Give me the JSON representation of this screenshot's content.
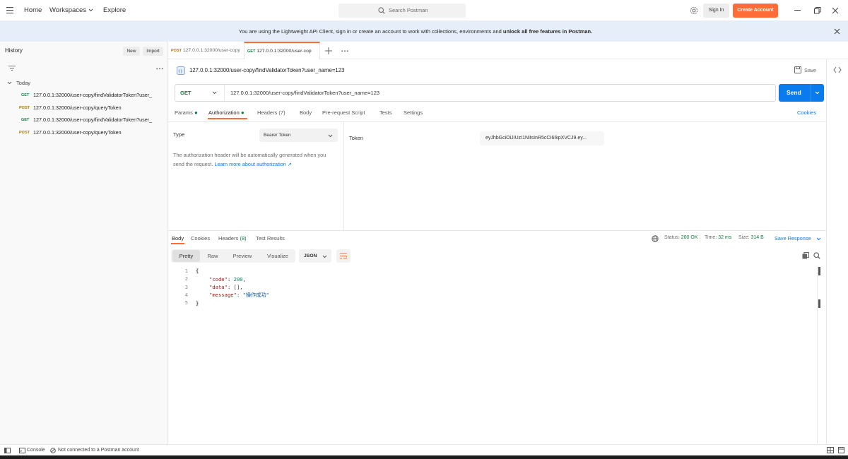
{
  "topbar": {
    "nav": [
      "Home",
      "Workspaces",
      "Explore"
    ],
    "search_placeholder": "Search Postman",
    "signin_label": "Sign In",
    "create_label": "Create Account"
  },
  "banner": {
    "text_plain": "You are using the Lightweight API Client, sign in or create an account to work with collections, environments and ",
    "text_bold": "unlock all free features in Postman."
  },
  "sidebar": {
    "title": "History",
    "new_label": "New",
    "import_label": "Import",
    "group_label": "Today",
    "items": [
      {
        "method": "GET",
        "url": "127.0.0.1:32000/user-copy/findValidatorToken?user_"
      },
      {
        "method": "POST",
        "url": "127.0.0.1:32000/user-copy/queryToken"
      },
      {
        "method": "GET",
        "url": "127.0.0.1:32000/user-copy/findValidatorToken?user_"
      },
      {
        "method": "POST",
        "url": "127.0.0.1:32000/user-copy/queryToken"
      }
    ]
  },
  "tabs": [
    {
      "method": "POST",
      "label": "127.0.0.1:32000/user-copy"
    },
    {
      "method": "GET",
      "label": "127.0.0.1:32000/user-cop"
    }
  ],
  "request": {
    "title": "127.0.0.1:32000/user-copy/findValidatorToken?user_name=123",
    "save_label": "Save",
    "method": "GET",
    "url": "127.0.0.1:32000/user-copy/findValidatorToken?user_name=123",
    "send_label": "Send",
    "subtabs": {
      "params": "Params",
      "authorization": "Authorization",
      "headers": "Headers (7)",
      "body": "Body",
      "prerequest": "Pre-request Script",
      "tests": "Tests",
      "settings": "Settings"
    },
    "cookies_label": "Cookies"
  },
  "auth": {
    "type_label": "Type",
    "type_value": "Bearer Token",
    "description": "The authorization header will be automatically generated when you send the request.",
    "learn_more": "Learn more about authorization ↗",
    "token_label": "Token",
    "token_value": "eyJhbGciOiJIUzI1NiIsInR5cCI6IkpXVCJ9.ey..."
  },
  "response": {
    "tabs": {
      "body": "Body",
      "cookies": "Cookies",
      "headers": "Headers",
      "headers_count": "(8)",
      "tests": "Test Results"
    },
    "status_label": "Status:",
    "status_value": "200 OK",
    "time_label": "Time:",
    "time_value": "32 ms",
    "size_label": "Size:",
    "size_value": "314 B",
    "save_response": "Save Response",
    "formats": [
      "Pretty",
      "Raw",
      "Preview",
      "Visualize"
    ],
    "lang": "JSON",
    "line_numbers": [
      "1",
      "2",
      "3",
      "4",
      "5"
    ],
    "code": {
      "open": "{",
      "code_key": "\"code\"",
      "code_val": "200",
      "data_key": "\"data\"",
      "data_val": "[]",
      "message_key": "\"message\"",
      "message_val": "\"操作成功\"",
      "close": "}"
    }
  },
  "statusbar": {
    "console": "Console",
    "offline": "Not connected to a Postman account"
  },
  "colors": {
    "accent": "#ff6c37",
    "send": "#097bed",
    "get": "#0f7a43",
    "post": "#ad7a03",
    "link": "#097bed"
  }
}
